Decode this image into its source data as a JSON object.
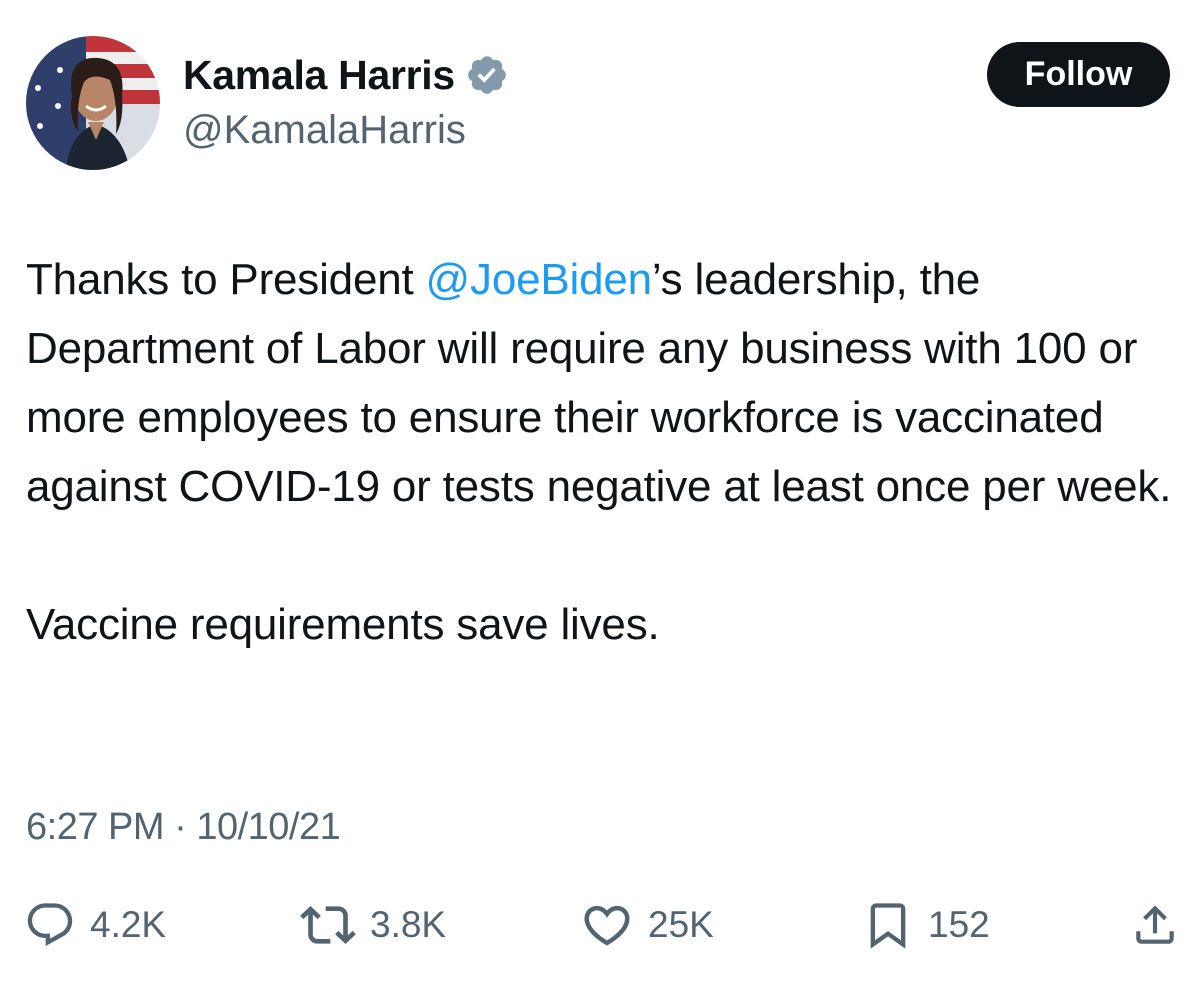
{
  "author": {
    "display_name": "Kamala Harris",
    "handle": "@KamalaHarris",
    "verified_icon": "verified-badge-icon",
    "badge_color": "#829aab"
  },
  "follow_button": {
    "label": "Follow"
  },
  "tweet": {
    "text_before_mention": "Thanks to President ",
    "mention": "@JoeBiden",
    "text_after_mention": "’s leadership, the Department of Labor will require any business with 100 or more employees to ensure their workforce is vaccinated against COVID-19 or tests negative at least once per week.",
    "second_paragraph": "Vaccine requirements save lives.",
    "mention_color": "#1d9bf0"
  },
  "meta": {
    "time": "6:27 PM",
    "separator": "·",
    "date": "10/10/21"
  },
  "actions": {
    "reply": {
      "icon": "reply-icon",
      "count": "4.2K"
    },
    "retweet": {
      "icon": "retweet-icon",
      "count": "3.8K"
    },
    "like": {
      "icon": "heart-icon",
      "count": "25K"
    },
    "bookmark": {
      "icon": "bookmark-icon",
      "count": "152"
    },
    "share": {
      "icon": "share-icon"
    }
  }
}
